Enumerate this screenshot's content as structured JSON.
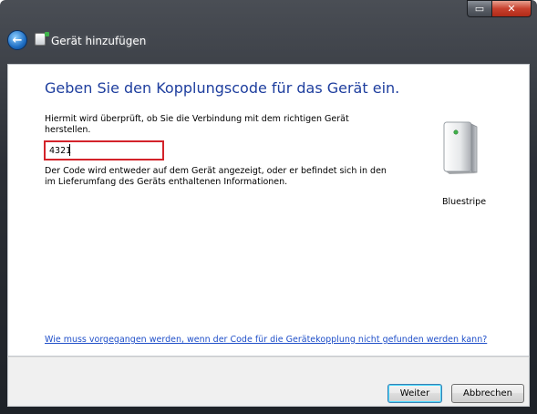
{
  "window": {
    "title": "Gerät hinzufügen",
    "caption": {
      "minimize_label": "▭",
      "close_label": "✕"
    }
  },
  "main": {
    "heading": "Geben Sie den Kopplungscode für das Gerät ein.",
    "description": "Hiermit wird überprüft, ob Sie die Verbindung mit dem richtigen Gerät herstellen.",
    "code_input": {
      "value": "4321",
      "placeholder": ""
    },
    "hint": "Der Code wird entweder auf dem Gerät angezeigt, oder er befindet sich in den im Lieferumfang des Geräts enthaltenen Informationen.",
    "device": {
      "name": "Bluestripe",
      "icon": "device-icon"
    },
    "help_link": "Wie muss vorgegangen werden, wenn der Code für die Gerätekopplung nicht gefunden werden kann?"
  },
  "footer": {
    "next_label": "Weiter",
    "cancel_label": "Abbrechen"
  },
  "colors": {
    "heading": "#1e3e9e",
    "link": "#1f4fc9",
    "input_highlight": "#d3232a"
  }
}
